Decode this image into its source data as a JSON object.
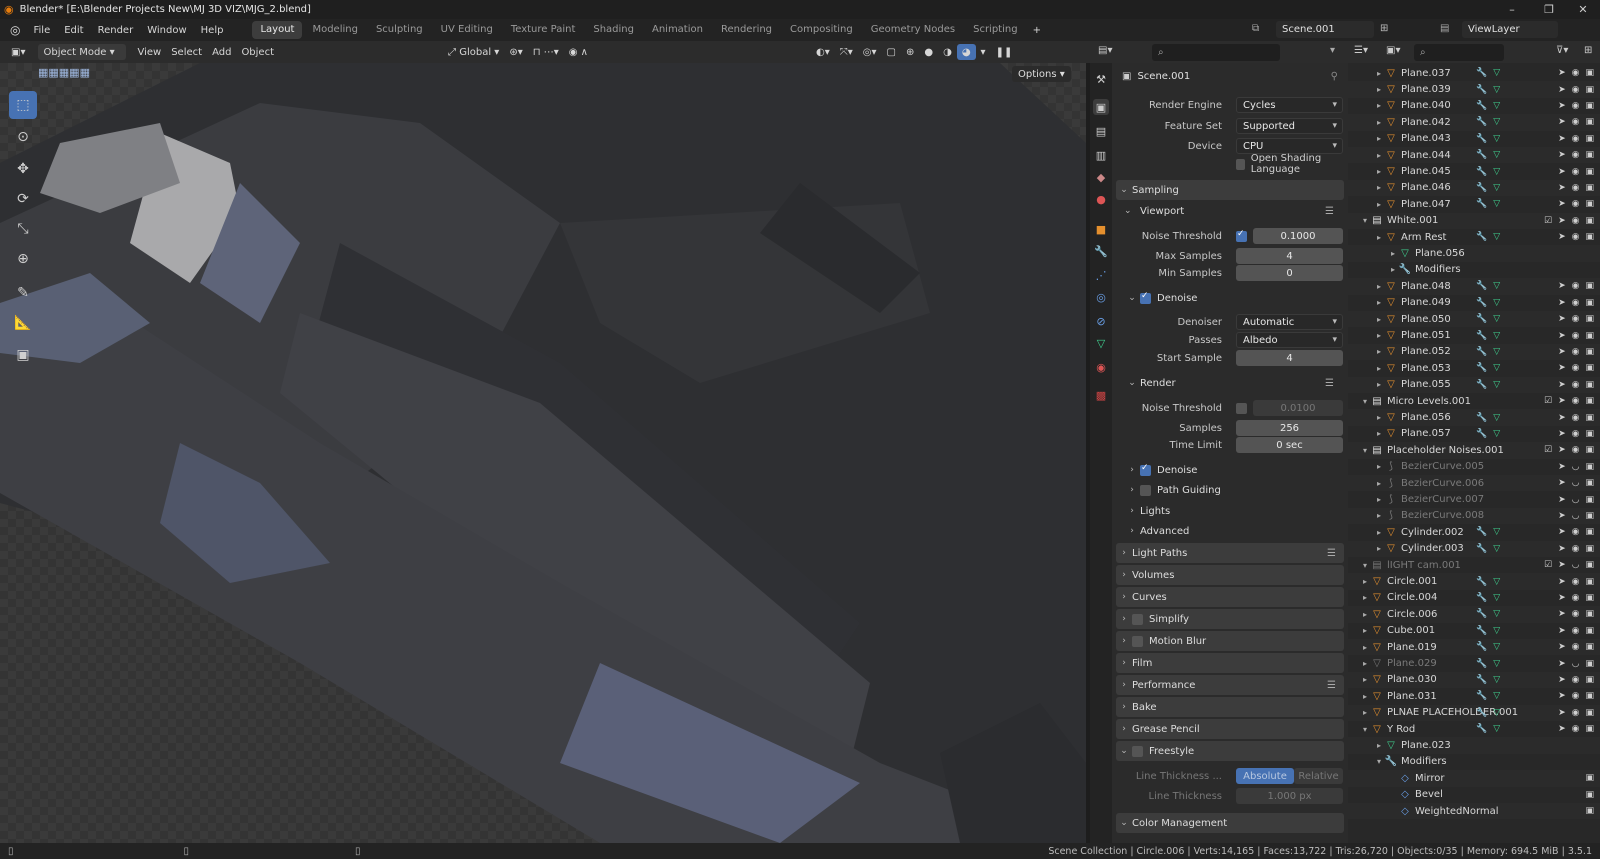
{
  "window": {
    "title": "Blender* [E:\\Blender Projects New\\MJ 3D VIZ\\MJG_2.blend]",
    "minimize": "–",
    "maximize": "❐",
    "close": "✕"
  },
  "menu": [
    "File",
    "Edit",
    "Render",
    "Window",
    "Help"
  ],
  "workspaces": [
    {
      "label": "Layout",
      "active": true
    },
    {
      "label": "Modeling"
    },
    {
      "label": "Sculpting"
    },
    {
      "label": "UV Editing"
    },
    {
      "label": "Texture Paint"
    },
    {
      "label": "Shading"
    },
    {
      "label": "Animation"
    },
    {
      "label": "Rendering"
    },
    {
      "label": "Compositing"
    },
    {
      "label": "Geometry Nodes"
    },
    {
      "label": "Scripting"
    }
  ],
  "add_workspace": "+",
  "scene": "Scene.001",
  "view_layer": "ViewLayer",
  "viewport_header": {
    "mode": "Object Mode",
    "menus": [
      "View",
      "Select",
      "Add",
      "Object"
    ],
    "transform_orientation": "Global",
    "options": "Options"
  },
  "properties": {
    "search_placeholder": "",
    "scene_name": "Scene.001",
    "render_engine_label": "Render Engine",
    "render_engine": "Cycles",
    "feature_set_label": "Feature Set",
    "feature_set": "Supported",
    "device_label": "Device",
    "device": "CPU",
    "osl_label": "Open Shading Language",
    "sampling": "Sampling",
    "viewport": "Viewport",
    "noise_threshold_label": "Noise Threshold",
    "vp_noise_threshold": "0.1000",
    "max_samples_label": "Max Samples",
    "max_samples": "4",
    "min_samples_label": "Min Samples",
    "min_samples": "0",
    "denoise": "Denoise",
    "denoiser_label": "Denoiser",
    "denoiser": "Automatic",
    "passes_label": "Passes",
    "passes": "Albedo",
    "start_sample_label": "Start Sample",
    "start_sample": "4",
    "render": "Render",
    "r_noise_threshold": "0.0100",
    "samples_label": "Samples",
    "samples": "256",
    "time_limit_label": "Time Limit",
    "time_limit": "0 sec",
    "path_guiding": "Path Guiding",
    "lights": "Lights",
    "advanced": "Advanced",
    "panels": [
      "Light Paths",
      "Volumes",
      "Curves",
      "Simplify",
      "Motion Blur",
      "Film",
      "Performance",
      "Bake",
      "Grease Pencil",
      "Freestyle"
    ],
    "line_thickness_mode_label": "Line Thickness ...",
    "line_thickness_absolute": "Absolute",
    "line_thickness_relative": "Relative",
    "line_thickness_label": "Line Thickness",
    "line_thickness": "1.000 px",
    "color_management": "Color Management"
  },
  "outliner": {
    "rows": [
      {
        "name": "Plane.037",
        "indent": 1,
        "type": "mesh"
      },
      {
        "name": "Plane.039",
        "indent": 1,
        "type": "mesh"
      },
      {
        "name": "Plane.040",
        "indent": 1,
        "type": "mesh"
      },
      {
        "name": "Plane.042",
        "indent": 1,
        "type": "mesh"
      },
      {
        "name": "Plane.043",
        "indent": 1,
        "type": "mesh"
      },
      {
        "name": "Plane.044",
        "indent": 1,
        "type": "mesh"
      },
      {
        "name": "Plane.045",
        "indent": 1,
        "type": "mesh"
      },
      {
        "name": "Plane.046",
        "indent": 1,
        "type": "mesh"
      },
      {
        "name": "Plane.047",
        "indent": 1,
        "type": "mesh"
      },
      {
        "name": "White.001",
        "indent": 0,
        "type": "collection"
      },
      {
        "name": "Arm Rest",
        "indent": 1,
        "type": "mesh"
      },
      {
        "name": "Plane.056",
        "indent": 2,
        "type": "data"
      },
      {
        "name": "Modifiers",
        "indent": 2,
        "type": "modifier"
      },
      {
        "name": "Plane.048",
        "indent": 1,
        "type": "mesh"
      },
      {
        "name": "Plane.049",
        "indent": 1,
        "type": "mesh"
      },
      {
        "name": "Plane.050",
        "indent": 1,
        "type": "mesh"
      },
      {
        "name": "Plane.051",
        "indent": 1,
        "type": "mesh"
      },
      {
        "name": "Plane.052",
        "indent": 1,
        "type": "mesh"
      },
      {
        "name": "Plane.053",
        "indent": 1,
        "type": "mesh"
      },
      {
        "name": "Plane.055",
        "indent": 1,
        "type": "mesh"
      },
      {
        "name": "Micro Levels.001",
        "indent": 0,
        "type": "collection"
      },
      {
        "name": "Plane.056",
        "indent": 1,
        "type": "mesh"
      },
      {
        "name": "Plane.057",
        "indent": 1,
        "type": "mesh"
      },
      {
        "name": "Placeholder Noises.001",
        "indent": 0,
        "type": "collection"
      },
      {
        "name": "BezierCurve.005",
        "indent": 1,
        "type": "curve",
        "dim": true
      },
      {
        "name": "BezierCurve.006",
        "indent": 1,
        "type": "curve",
        "dim": true
      },
      {
        "name": "BezierCurve.007",
        "indent": 1,
        "type": "curve",
        "dim": true
      },
      {
        "name": "BezierCurve.008",
        "indent": 1,
        "type": "curve",
        "dim": true
      },
      {
        "name": "Cylinder.002",
        "indent": 1,
        "type": "mesh"
      },
      {
        "name": "Cylinder.003",
        "indent": 1,
        "type": "mesh"
      },
      {
        "name": "lIGHT cam.001",
        "indent": 0,
        "type": "collection",
        "dim": true
      },
      {
        "name": "Circle.001",
        "indent": 0,
        "type": "mesh"
      },
      {
        "name": "Circle.004",
        "indent": 0,
        "type": "mesh"
      },
      {
        "name": "Circle.006",
        "indent": 0,
        "type": "mesh"
      },
      {
        "name": "Cube.001",
        "indent": 0,
        "type": "mesh"
      },
      {
        "name": "Plane.019",
        "indent": 0,
        "type": "mesh"
      },
      {
        "name": "Plane.029",
        "indent": 0,
        "type": "mesh",
        "dim": true
      },
      {
        "name": "Plane.030",
        "indent": 0,
        "type": "mesh"
      },
      {
        "name": "Plane.031",
        "indent": 0,
        "type": "mesh"
      },
      {
        "name": "PLNAE PLACEHOLDER.001",
        "indent": 0,
        "type": "mesh"
      },
      {
        "name": "Y Rod",
        "indent": 0,
        "type": "mesh"
      },
      {
        "name": "Plane.023",
        "indent": 1,
        "type": "data"
      },
      {
        "name": "Modifiers",
        "indent": 1,
        "type": "modifier"
      },
      {
        "name": "Mirror",
        "indent": 2,
        "type": "mod-item"
      },
      {
        "name": "Bevel",
        "indent": 2,
        "type": "mod-item"
      },
      {
        "name": "WeightedNormal",
        "indent": 2,
        "type": "mod-item"
      }
    ]
  },
  "status": "Scene Collection | Circle.006 | Verts:14,165 | Faces:13,722 | Tris:26,720 | Objects:0/35 | Memory: 694.5 MiB | 3.5.1",
  "colors": {
    "accent": "#4772b3",
    "mesh_icon": "#e5902e",
    "data_icon": "#3fcf8e",
    "bg_viewport": "#383838"
  },
  "icons": [
    "blender-logo-icon",
    "select-box-icon",
    "cursor-icon",
    "move-icon",
    "rotate-icon",
    "scale-icon",
    "transform-icon",
    "annotate-icon",
    "measure-icon",
    "add-cube-icon",
    "search-icon",
    "eye-icon",
    "camera-icon",
    "filter-icon",
    "pin-icon"
  ]
}
